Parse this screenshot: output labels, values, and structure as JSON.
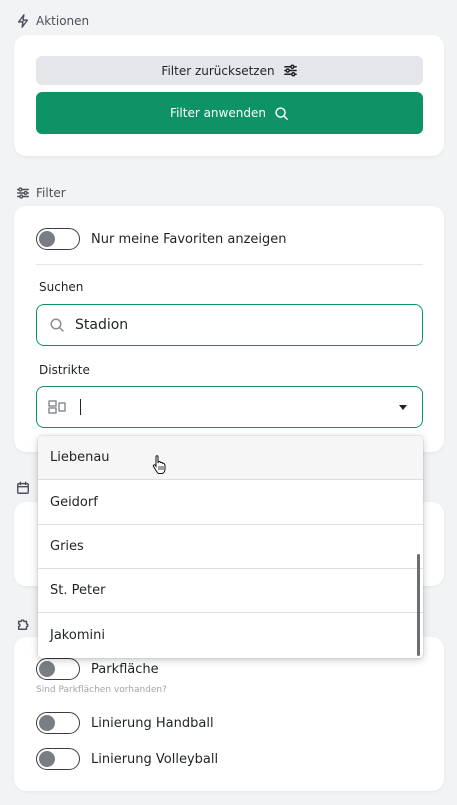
{
  "actions": {
    "heading": "Aktionen",
    "reset_label": "Filter zurücksetzen",
    "apply_label": "Filter anwenden"
  },
  "filter": {
    "heading": "Filter",
    "favorites_label": "Nur meine Favoriten anzeigen",
    "favorites_on": false,
    "search_label": "Suchen",
    "search_value": "Stadion",
    "districts_label": "Distrikte",
    "districts_value": ""
  },
  "districts_dropdown": {
    "options": [
      "Liebenau",
      "Geidorf",
      "Gries",
      "St. Peter",
      "Jakomini"
    ],
    "hovered": "Liebenau"
  },
  "features": {
    "items": [
      {
        "label": "Parkfläche",
        "hint": "Sind Parkflächen vorhanden?",
        "on": false
      },
      {
        "label": "Linierung Handball",
        "on": false
      },
      {
        "label": "Linierung Volleyball",
        "on": false
      }
    ]
  },
  "colors": {
    "accent": "#0e9366",
    "background": "#f2f3f5",
    "card": "#ffffff"
  },
  "icons": [
    "lightning-icon",
    "sliders-icon",
    "search-icon",
    "calendar-icon",
    "puzzle-icon",
    "grid-icon",
    "chevron-down-icon",
    "hand-pointer-icon"
  ]
}
